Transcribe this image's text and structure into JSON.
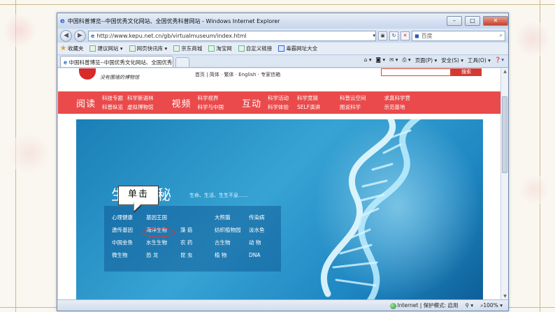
{
  "window": {
    "title": "中国科普博览--中国优秀文化网站、全国优秀科普网站 - Windows Internet Explorer",
    "minimize_icon": "minimize-icon",
    "maximize_icon": "maximize-icon",
    "close_icon": "close-icon"
  },
  "address": {
    "url": "http://www.kepu.net.cn/gb/virtualmuseum/index.html",
    "search_placeholder": "百度"
  },
  "favorites": {
    "label": "收藏夹",
    "links": [
      "建议网站 ▾",
      "网页快讯库 ▾",
      "京东商城",
      "淘宝网",
      "自定义链接",
      "毒霸网址大全"
    ]
  },
  "tab": {
    "title": "中国科普博览--中国优秀文化网站、全国优秀科..."
  },
  "command_bar": [
    "页面(P) ▾",
    "安全(S) ▾",
    "工具(O) ▾"
  ],
  "site": {
    "slogan": "没有围墙的博物馆",
    "head_links": "首页 | 简体 · 繁体 · English · 专家信箱",
    "search_button": "搜索",
    "nav": [
      {
        "big": "阅读",
        "items": [
          "科技专题",
          "科学新语林",
          "科普纵览",
          "虚拟博物馆"
        ]
      },
      {
        "big": "视频",
        "items": [
          "科学视界",
          "科学与中国"
        ]
      },
      {
        "big": "互动",
        "items": [
          "科学活动",
          "科学竞猜",
          "科学体验",
          "SELF演讲",
          "科普云空间",
          "求真科学营",
          "图说科学",
          "示范基地"
        ]
      }
    ]
  },
  "banner": {
    "title": "生命奥秘",
    "subtitle": "生命、生活、生生不息……",
    "topics": [
      [
        "心理健康",
        "基因王国",
        "",
        "大熊猫",
        "传染病"
      ],
      [
        "遗传基因",
        "海洋生物",
        "藻 菇",
        "纺织植物园",
        "淡水鱼"
      ],
      [
        "中国金鱼",
        "水生生物",
        "农 药",
        "古生物",
        "动 物"
      ],
      [
        "微生物",
        "恐 龙",
        "昆 虫",
        "植 物",
        "DNA"
      ]
    ]
  },
  "callout": {
    "label": "单击"
  },
  "status": {
    "zone": "Internet | 保护模式: 启用",
    "zoom": "100%"
  },
  "colors": {
    "nav_red": "#ea4a4b",
    "banner_blue": "#2b95cc",
    "ie_chrome": "#d6e2f2"
  }
}
